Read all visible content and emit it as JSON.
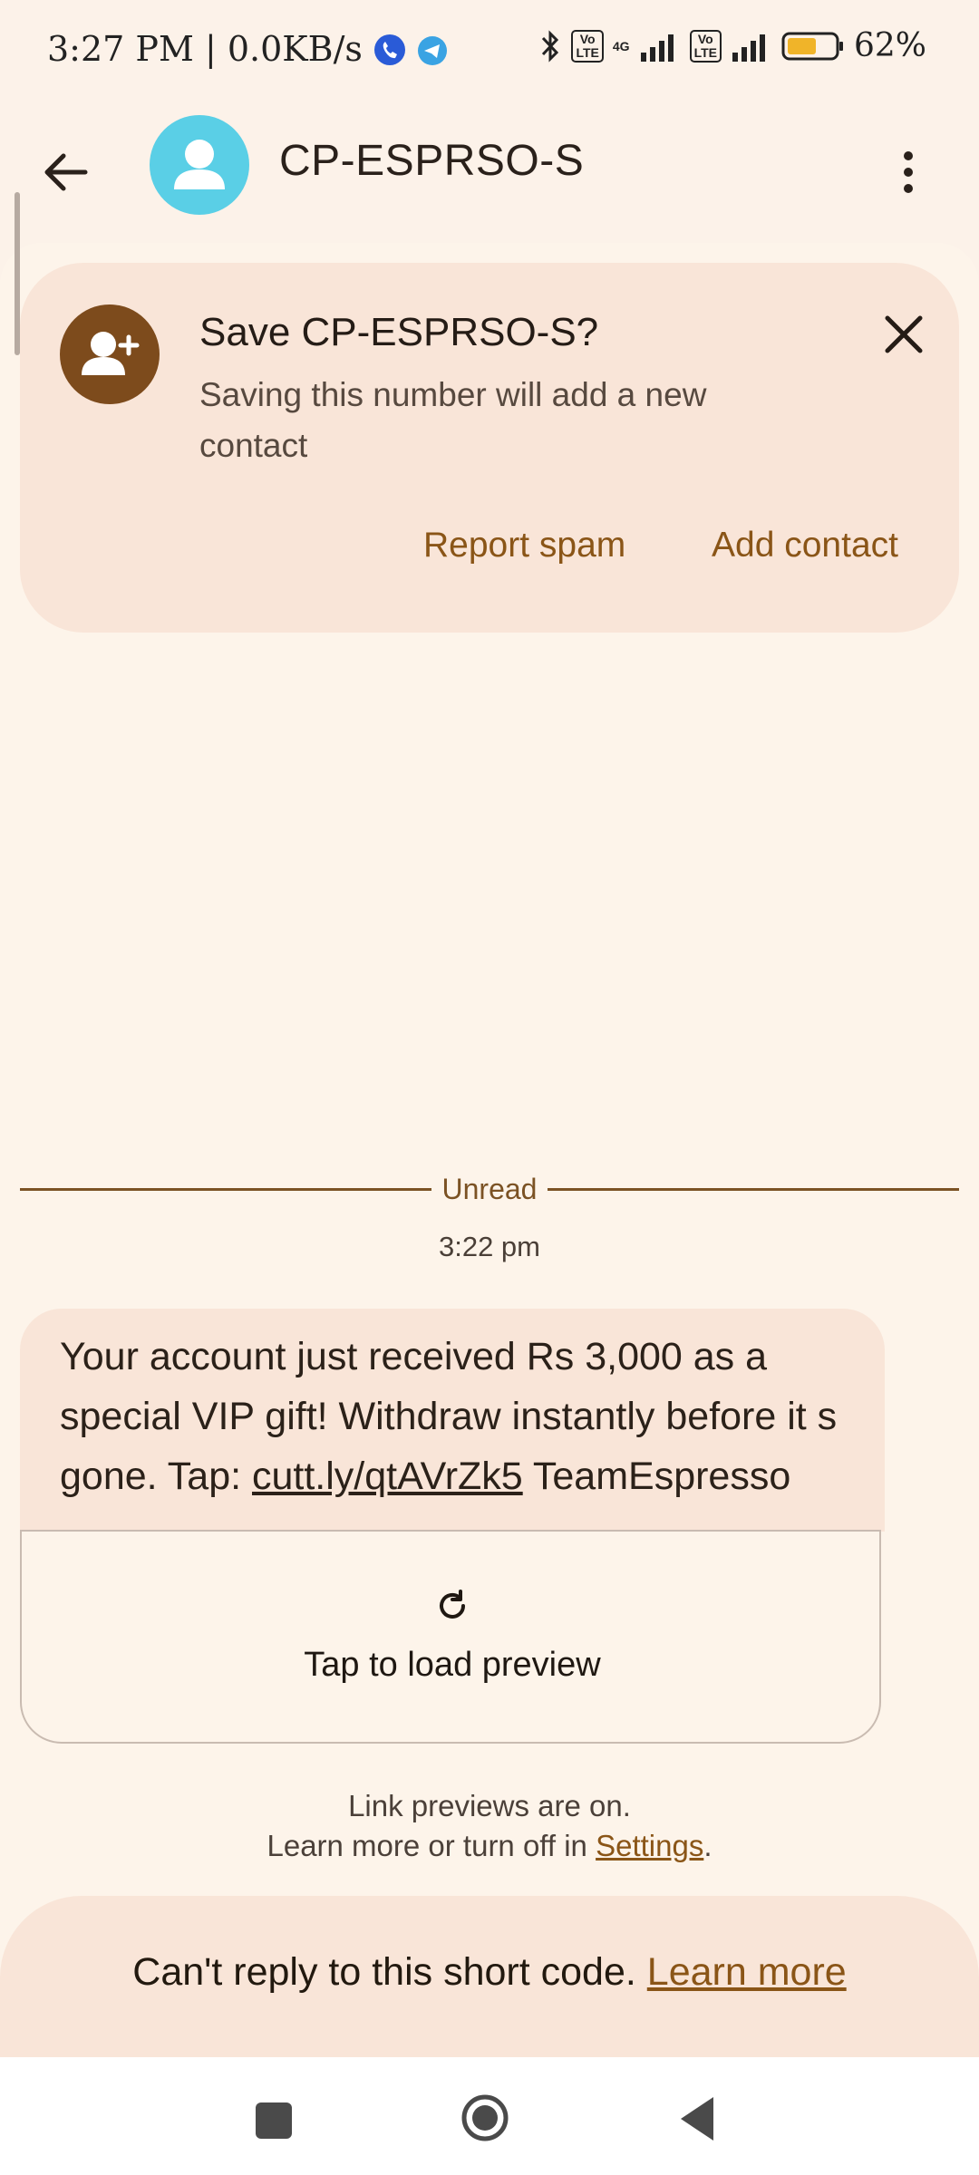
{
  "status_bar": {
    "time_speed": "3:27 PM | 0.0KB/s",
    "network_1": "4G",
    "battery_percent": "62%",
    "battery_level": 0.62
  },
  "header": {
    "contact_name": "CP-ESPRSO-S"
  },
  "save_card": {
    "title": "Save CP-ESPRSO-S?",
    "description": "Saving this number will add a new contact",
    "report_label": "Report spam",
    "add_label": "Add contact"
  },
  "divider": {
    "unread_label": "Unread",
    "timestamp": "3:22 pm"
  },
  "message": {
    "text_before": "Your account just received Rs 3,000 as a special VIP gift! Withdraw instantly before it s gone. Tap: ",
    "link": "cutt.ly/qtAVrZk5",
    "text_after": " TeamEspresso",
    "preview_label": "Tap to load preview"
  },
  "link_note": {
    "line1": "Link previews are on.",
    "line2_prefix": "Learn more or turn off in ",
    "settings_link": "Settings",
    "line2_suffix": "."
  },
  "footer": {
    "notice": "Can't reply to this short code. ",
    "learn_more": "Learn more"
  },
  "colors": {
    "background": "#fcf2e9",
    "card": "#f9e5d8",
    "accent": "#8a5517",
    "avatar": "#5acfe6",
    "save_avatar": "#7d4b1c"
  }
}
